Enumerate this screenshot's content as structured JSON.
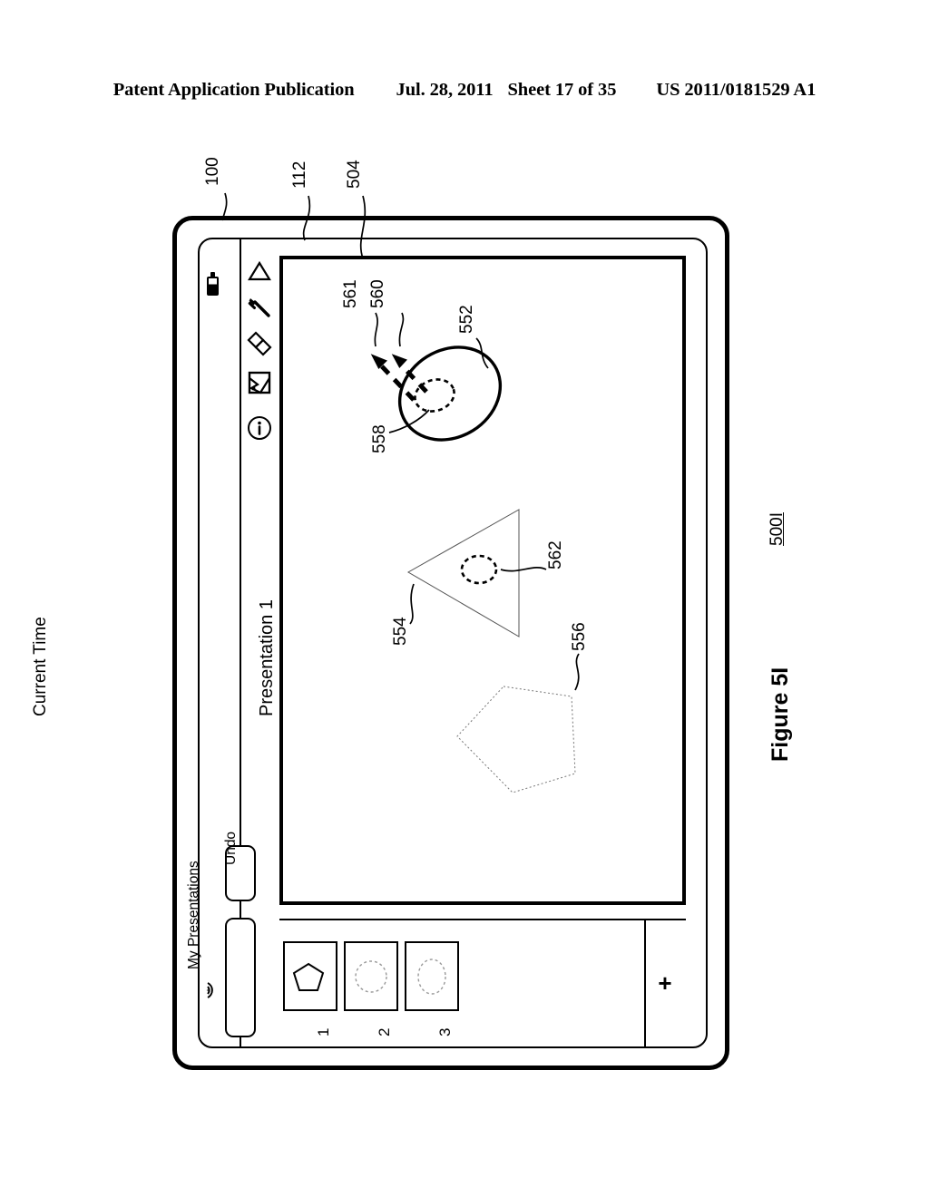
{
  "header": {
    "publication": "Patent Application Publication",
    "date": "Jul. 28, 2011",
    "sheet": "Sheet 17 of 35",
    "patent_number": "US 2011/0181529 A1"
  },
  "figure": {
    "caption": "Figure 5I",
    "reference": "500I"
  },
  "callouts": {
    "device": "100",
    "display": "112",
    "canvas": "504",
    "ellipse": "552",
    "triangle": "554",
    "pentagon": "556",
    "selection_handle": "558",
    "arrow_first": "560",
    "arrow_second": "561",
    "triangle_handle": "562"
  },
  "status_bar": {
    "time": "Current Time",
    "battery_icon": "battery-icon",
    "wifi_icon": "wifi-signal-icon"
  },
  "app": {
    "title": "Presentation 1"
  },
  "toolbar": {
    "items": [
      {
        "icon": "triangle-shape-icon",
        "name": "shapes-tool"
      },
      {
        "icon": "wrench-icon",
        "name": "tools-tool"
      },
      {
        "icon": "diamonds-icon",
        "name": "effects-tool"
      },
      {
        "icon": "image-icon",
        "name": "media-tool"
      },
      {
        "icon": "info-circle-icon",
        "name": "info-tool"
      }
    ]
  },
  "buttons": {
    "undo": "Undo",
    "my_presentations": "My Presentations",
    "add_slide": "+"
  },
  "slides": [
    {
      "number": "1",
      "shape": "pentagon"
    },
    {
      "number": "2",
      "shape": "circle"
    },
    {
      "number": "3",
      "shape": "ellipse"
    }
  ],
  "colors": {
    "ink": "#000000",
    "faint": "#777777",
    "page": "#ffffff"
  }
}
